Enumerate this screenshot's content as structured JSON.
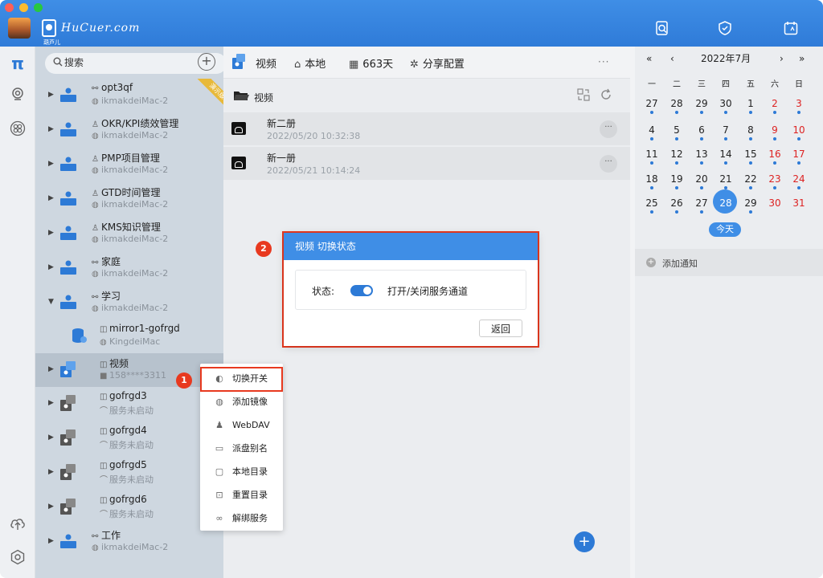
{
  "brand": {
    "name": "HuCuer.com",
    "sub": "葫芦儿"
  },
  "search": {
    "placeholder": "搜索"
  },
  "tree": [
    {
      "title": "opt3qf",
      "sub": "ikmakdeiMac-2",
      "ribbon": "演示版"
    },
    {
      "title": "OKR/KPI绩效管理",
      "sub": "ikmakdeiMac-2"
    },
    {
      "title": "PMP项目管理",
      "sub": "ikmakdeiMac-2"
    },
    {
      "title": "GTD时间管理",
      "sub": "ikmakdeiMac-2"
    },
    {
      "title": "KMS知识管理",
      "sub": "ikmakdeiMac-2"
    },
    {
      "title": "家庭",
      "sub": "ikmakdeiMac-2"
    },
    {
      "title": "学习",
      "sub": "ikmakdeiMac-2"
    },
    {
      "title": "mirror1-gofrgd",
      "sub": "KingdeiMac"
    },
    {
      "title": "视频",
      "sub": "158****3311"
    },
    {
      "title": "gofrgd3",
      "sub": "服务未启动"
    },
    {
      "title": "gofrgd4",
      "sub": "服务未启动"
    },
    {
      "title": "gofrgd5",
      "sub": "服务未启动"
    },
    {
      "title": "gofrgd6",
      "sub": "服务未启动"
    },
    {
      "title": "工作",
      "sub": "ikmakdeiMac-2"
    }
  ],
  "toolbar": {
    "name": "视频",
    "local": "本地",
    "days": "663天",
    "share": "分享配置",
    "more": "···"
  },
  "path": {
    "label": "视频"
  },
  "files": [
    {
      "title": "新二册",
      "date": "2022/05/20 10:32:38"
    },
    {
      "title": "新一册",
      "date": "2022/05/21 10:14:24"
    }
  ],
  "dialog": {
    "title": "视频 切换状态",
    "state_label": "状态:",
    "toggle_text": "打开/关闭服务通道",
    "toggle_on": true,
    "back": "返回",
    "badge": "2"
  },
  "context_menu": {
    "badge": "1",
    "items": [
      {
        "label": "切换开关",
        "icon": "toggle-icon"
      },
      {
        "label": "添加镜像",
        "icon": "database-icon"
      },
      {
        "label": "WebDAV",
        "icon": "user-icon"
      },
      {
        "label": "派盘别名",
        "icon": "drive-icon"
      },
      {
        "label": "本地目录",
        "icon": "monitor-icon"
      },
      {
        "label": "重置目录",
        "icon": "reset-icon"
      },
      {
        "label": "解绑服务",
        "icon": "unlink-icon"
      }
    ]
  },
  "calendar": {
    "nav": {
      "prev_year": "«",
      "prev_month": "‹",
      "next_month": "›",
      "next_year": "»"
    },
    "title": "2022年7月",
    "weekdays": [
      "一",
      "二",
      "三",
      "四",
      "五",
      "六",
      "日"
    ],
    "weeks": [
      [
        "27",
        "28",
        "29",
        "30",
        "1",
        "2",
        "3"
      ],
      [
        "4",
        "5",
        "6",
        "7",
        "8",
        "9",
        "10"
      ],
      [
        "11",
        "12",
        "13",
        "14",
        "15",
        "16",
        "17"
      ],
      [
        "18",
        "19",
        "20",
        "21",
        "22",
        "23",
        "24"
      ],
      [
        "25",
        "26",
        "27",
        "28",
        "29",
        "30",
        "31"
      ]
    ],
    "today_day": "28",
    "today_button": "今天",
    "add_notice": "添加通知",
    "colors": {
      "weekend": "#dd2222",
      "accent": "#3f8ee6"
    }
  },
  "colors": {
    "accent": "#2d7ad6",
    "highlight": "#e8391f",
    "header": "#3f8ee6"
  }
}
